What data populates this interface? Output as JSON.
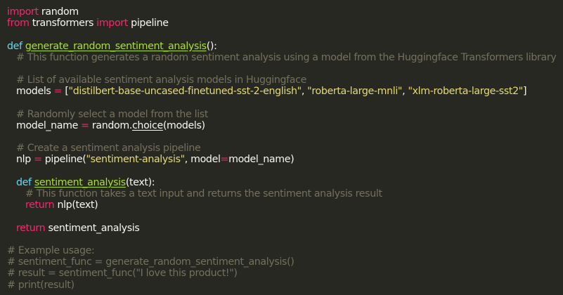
{
  "code": {
    "l1_kw": "import",
    "l1_rest": " random",
    "l2_kw_from": "from",
    "l2_mod": " transformers ",
    "l2_kw_import": "import",
    "l2_rest": " pipeline",
    "l3_def": "def",
    "l3_fn": "generate_random_sentiment_analysis",
    "l3_rest": "():",
    "l4_cm": "# This function generates a random sentiment analysis using a model from the Huggingface Transformers library",
    "l5_cm": "# List of available sentiment analysis models in Huggingface",
    "l6_var": "models ",
    "l6_eq": "=",
    "l6_b1": " [",
    "l6_s1": "\"distilbert-base-uncased-finetuned-sst-2-english\"",
    "l6_c1": ", ",
    "l6_s2": "\"roberta-large-mnli\"",
    "l6_c2": ", ",
    "l6_s3": "\"xlm-roberta-large-sst2\"",
    "l6_b2": "]",
    "l7_cm": "# Randomly select a model from the list",
    "l8_var": "model_name ",
    "l8_eq": "=",
    "l8_mod": " random",
    "l8_dot": ".",
    "l8_call": "choice",
    "l8_rest": "(models)",
    "l9_cm": "# Create a sentiment analysis pipeline",
    "l10_var": "nlp ",
    "l10_eq": "=",
    "l10_call": " pipeline(",
    "l10_s1": "\"sentiment-analysis\"",
    "l10_c1": ", model",
    "l10_eq2": "=",
    "l10_rest": "model_name)",
    "l11_def": "def",
    "l11_fn": "sentiment_analysis",
    "l11_paren": "(",
    "l11_arg": "text",
    "l11_rest": "):",
    "l12_cm": "# This function takes a text input and returns the sentiment analysis result",
    "l13_ret": "return",
    "l13_rest": " nlp(text)",
    "l14_ret": "return",
    "l14_rest": " sentiment_analysis",
    "l15_cm": "# Example usage:",
    "l16_cm": "# sentiment_func = generate_random_sentiment_analysis()",
    "l17_cm": "# result = sentiment_func(\"I love this product!\")",
    "l18_cm": "# print(result)"
  },
  "colors": {
    "background": "#272822",
    "keyword": "#f92672",
    "function": "#a6e22e",
    "string": "#e6db74",
    "comment": "#75715e",
    "plain": "#f8f8f2"
  }
}
